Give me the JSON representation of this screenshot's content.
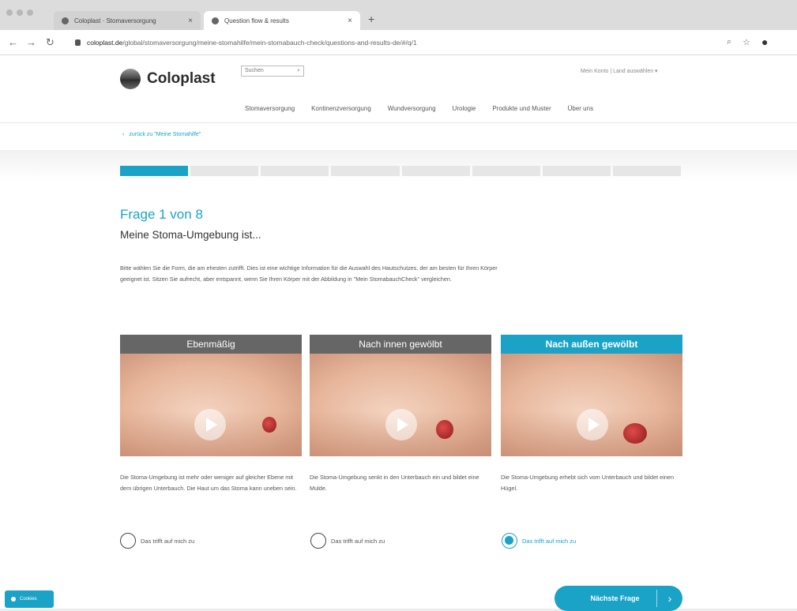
{
  "browser": {
    "tabs": [
      {
        "label": "Coloplast · Stomaversorgung"
      },
      {
        "label": "Question flow & results"
      }
    ],
    "url_domain": "coloplast.de",
    "url_path": "/global/stomaversorgung/meine-stomahilfe/mein-stomabauch-check/questions-and-results-de/#/q/1"
  },
  "header": {
    "brand": "Coloplast",
    "search_placeholder": "Suchen",
    "login": "Mein Konto  |  Land auswählen ▾",
    "nav": [
      "Stomaversorgung",
      "Kontinenzversorgung",
      "Wundversorgung",
      "Urologie",
      "Produkte und Muster",
      "Über uns"
    ],
    "back_link": "zurück zu \"Meine Stomahilfe\""
  },
  "progress": {
    "current": 1,
    "total": 8
  },
  "question": {
    "title": "Frage 1 von 8",
    "subtitle": "Meine Stoma-Umgebung ist...",
    "description": "Bitte wählen Sie die Form, die am ehesten zutrifft. Dies ist eine wichtige Information für die Auswahl des Hautschutzes, der am besten für Ihren Körper geeignet ist. Sitzen Sie aufrecht, aber entspannt, wenn Sie Ihren Körper mit der Abbildung in \"Mein StomabauchCheck\" vergleichen."
  },
  "options": [
    {
      "title": "Ebenmäßig",
      "text": "Die Stoma-Umgebung ist mehr oder weniger auf gleicher Ebene mit dem übrigen Unterbauch. Die Haut um das Stoma kann uneben sein.",
      "radio_label": "Das trifft auf mich zu",
      "selected": false
    },
    {
      "title": "Nach innen gewölbt",
      "text": "Die Stoma-Umgebung senkt in den Unterbauch ein und bildet eine Mulde.",
      "radio_label": "Das trifft auf mich zu",
      "selected": false
    },
    {
      "title": "Nach außen gewölbt",
      "text": "Die Stoma-Umgebung erhebt sich vom Unterbauch und bildet einen Hügel.",
      "radio_label": "Das trifft auf mich zu",
      "selected": true
    }
  ],
  "next_button": "Nächste Frage",
  "cookie_label": "Cookies",
  "colors": {
    "accent": "#1aa3c7",
    "header_gray": "#666666"
  }
}
